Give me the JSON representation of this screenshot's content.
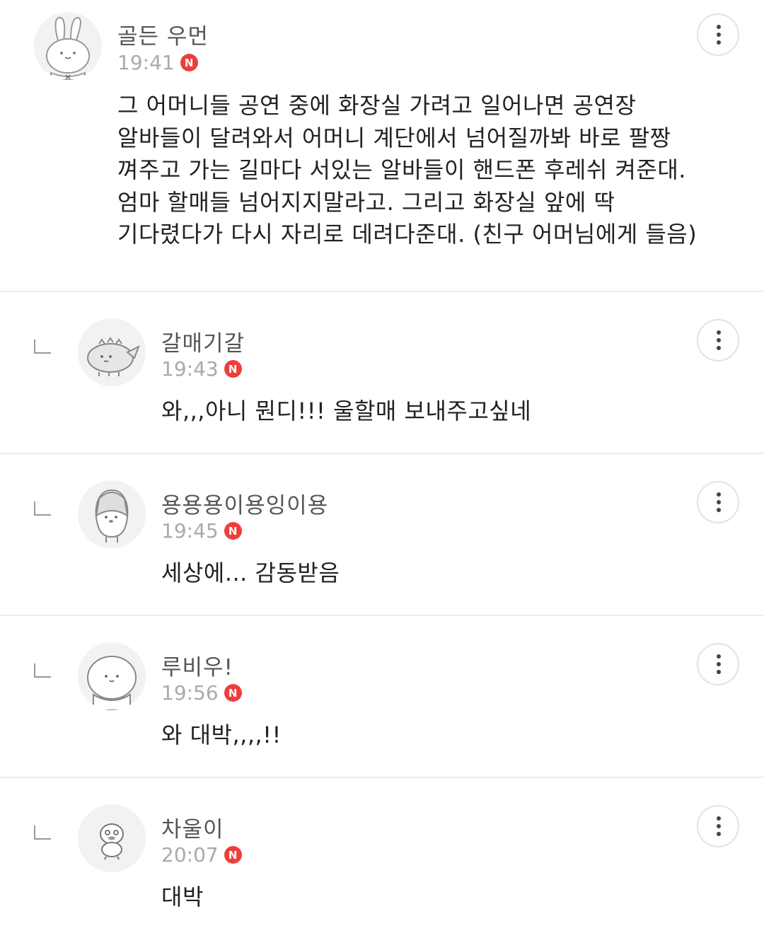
{
  "comments": [
    {
      "author": "골든 우먼",
      "time": "19:41",
      "badge": "N",
      "avatar_icon": "bunny-avatar-icon",
      "lines": [
        "그 어머니들 공연 중에 화장실 가려고 일어나면 공연장",
        "알바들이 달려와서 어머니 계단에서 넘어질까봐 바로 팔짱",
        "껴주고 가는 길마다 서있는 알바들이 핸드폰 후레쉬 켜준대.",
        "엄마 할매들 넘어지지말라고. 그리고 화장실 앞에 딱",
        "기다렸다가 다시 자리로 데려다준대. (친구 어머님에게 들음)"
      ]
    },
    {
      "author": "갈매기갈",
      "time": "19:43",
      "badge": "N",
      "avatar_icon": "dinosaur-avatar-icon",
      "text": "와,,,아니 뭔디!!! 울할매 보내주고싶네"
    },
    {
      "author": "용용용이용잉이용",
      "time": "19:45",
      "badge": "N",
      "avatar_icon": "penguin-avatar-icon",
      "text": "세상에... 감동받음"
    },
    {
      "author": "루비우!",
      "time": "19:56",
      "badge": "N",
      "avatar_icon": "blob-avatar-icon",
      "text": "와 대박,,,,!!"
    },
    {
      "author": "차울이",
      "time": "20:07",
      "badge": "N",
      "avatar_icon": "duck-avatar-icon",
      "text": "대박"
    }
  ],
  "colors": {
    "badge": "#ee3e3b",
    "divider": "#ececec",
    "meta": "#aaaaaa"
  }
}
